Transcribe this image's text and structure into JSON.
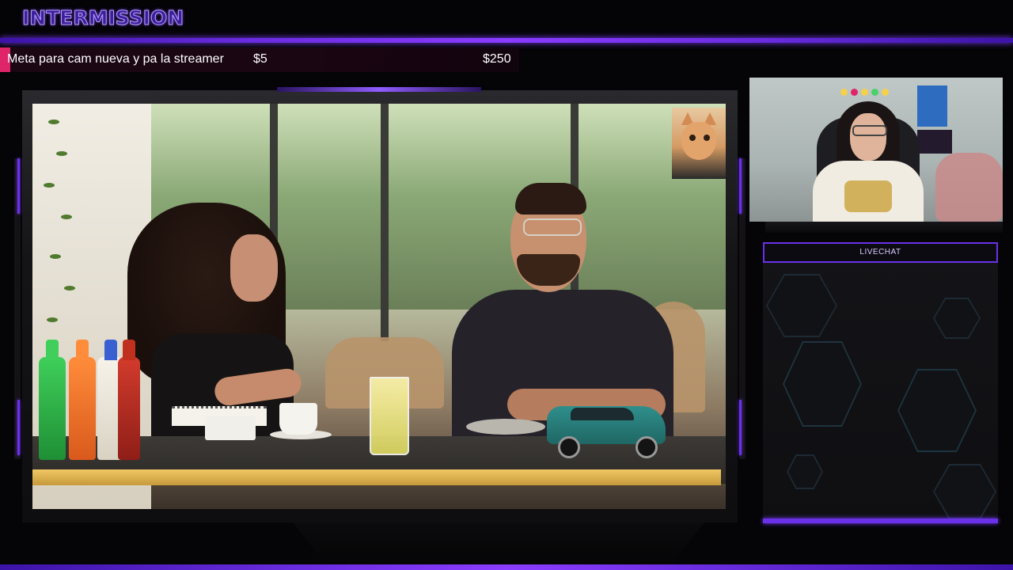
{
  "header": {
    "title": "INTERMISSION"
  },
  "goal": {
    "label": "Meta para cam nueva y pa la streamer",
    "current": "$5",
    "target": "$250",
    "progress_fraction": 0.02
  },
  "video": {
    "scene": "interview-cafe",
    "overlay_icon": "cat-face-icon"
  },
  "webcam": {
    "subject": "streamer-webcam"
  },
  "chat": {
    "header_label": "LIVECHAT"
  },
  "colors": {
    "accent": "#7a3cff",
    "goal_fill": "#e0246a",
    "background": "#050407"
  }
}
